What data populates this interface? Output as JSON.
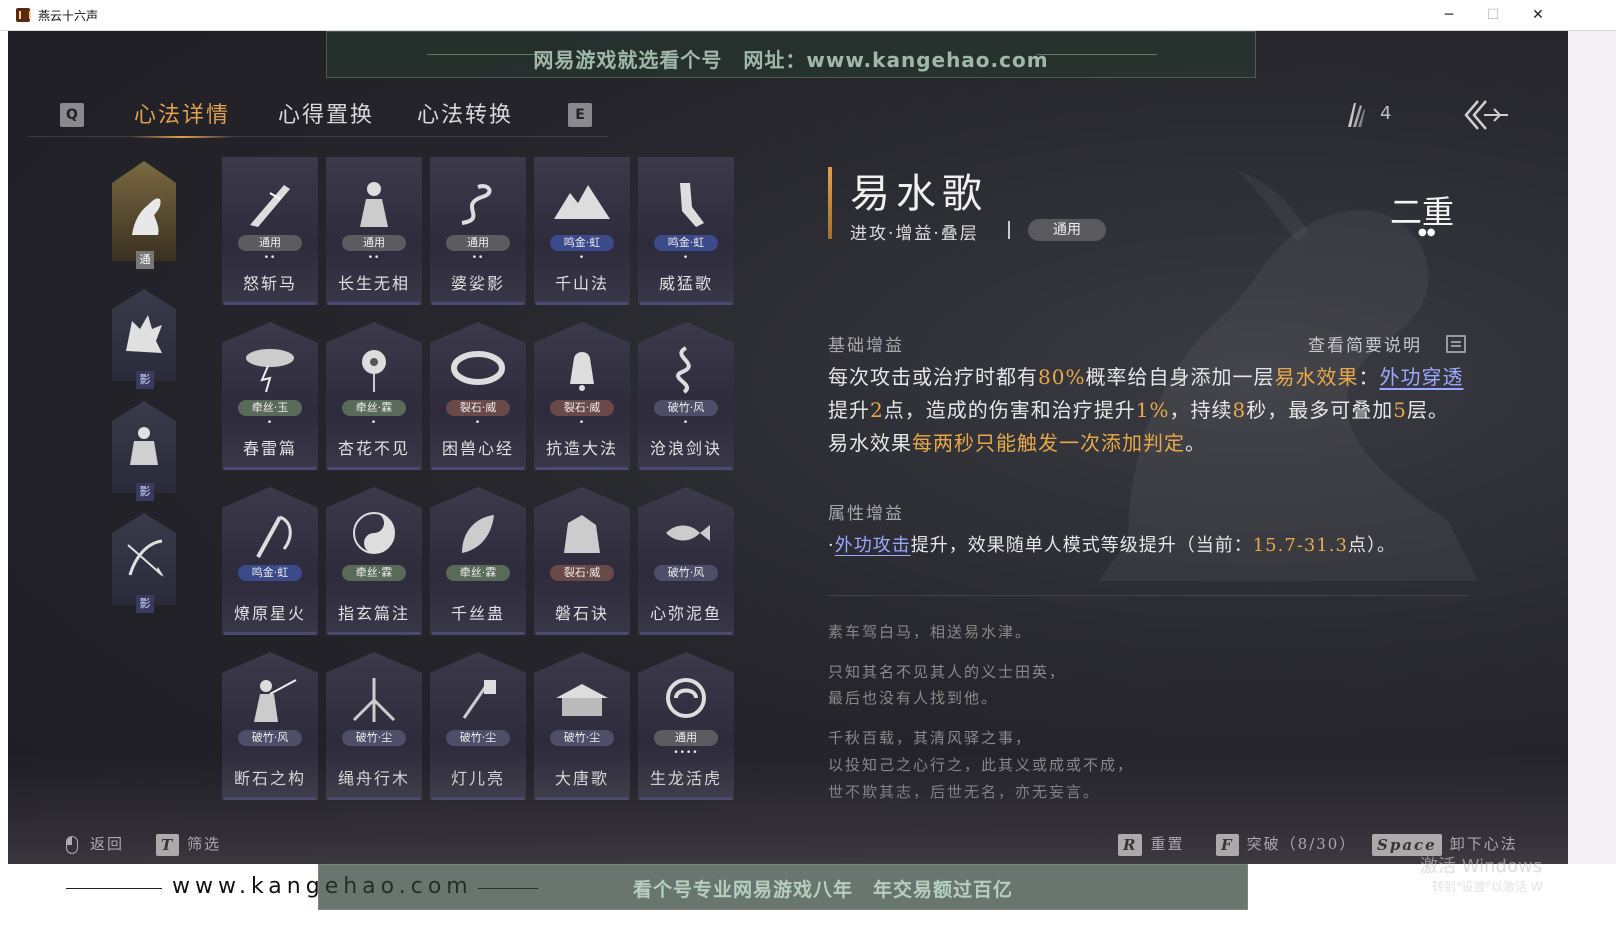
{
  "window": {
    "title": "燕云十六声",
    "minimize": "─",
    "maximize": "☐",
    "close": "✕"
  },
  "watermark": {
    "top": "网易游戏就选看个号　网址：www.kangehao.com",
    "bottom_url": "www.kangehao.com",
    "bottom_text": "看个号专业网易游戏八年　年交易额过百亿"
  },
  "tabs": {
    "prev_key": "Q",
    "next_key": "E",
    "items": [
      {
        "label": "心法详情",
        "active": true
      },
      {
        "label": "心得置换",
        "active": false
      },
      {
        "label": "心法转换",
        "active": false
      }
    ]
  },
  "currency": {
    "icon": "feather-icon",
    "value": "4"
  },
  "sidebar": [
    {
      "icon": "horse-icon",
      "tag": "通",
      "active": true
    },
    {
      "icon": "wolf-icon",
      "tag": "影",
      "active": false
    },
    {
      "icon": "warrior-icon",
      "tag": "影",
      "active": false
    },
    {
      "icon": "bow-icon",
      "tag": "影",
      "active": false
    }
  ],
  "cards": [
    {
      "name": "怒斩马",
      "badge": "通用",
      "type": "general",
      "dots": "••",
      "icon": "blade-icon"
    },
    {
      "name": "长生无相",
      "badge": "通用",
      "type": "general",
      "dots": "••",
      "icon": "figure-icon"
    },
    {
      "name": "婆娑影",
      "badge": "通用",
      "type": "general",
      "dots": "••",
      "icon": "dragon-icon"
    },
    {
      "name": "千山法",
      "badge": "鸣金·虹",
      "type": "mingjin",
      "dots": "•",
      "icon": "mountain-icon"
    },
    {
      "name": "威猛歌",
      "badge": "鸣金·虹",
      "type": "mingjin",
      "dots": "•",
      "icon": "arm-icon"
    },
    {
      "name": "春雷篇",
      "badge": "牵丝·玉",
      "type": "qiansi",
      "dots": "•",
      "icon": "storm-icon"
    },
    {
      "name": "杏花不见",
      "badge": "牵丝·霖",
      "type": "qiansi",
      "dots": "•",
      "icon": "flower-icon"
    },
    {
      "name": "困兽心经",
      "badge": "裂石·威",
      "type": "lieshi",
      "dots": "•",
      "icon": "collar-icon"
    },
    {
      "name": "抗造大法",
      "badge": "裂石·威",
      "type": "lieshi",
      "dots": "•",
      "icon": "bell-icon"
    },
    {
      "name": "沧浪剑诀",
      "badge": "破竹·风",
      "type": "pozhu",
      "dots": "•",
      "icon": "serpent-icon"
    },
    {
      "name": "燎原星火",
      "badge": "鸣金·虹",
      "type": "mingjin",
      "dots": "",
      "icon": "scythe-icon"
    },
    {
      "name": "指玄篇注",
      "badge": "牵丝·霖",
      "type": "qiansi",
      "dots": "",
      "icon": "yinyang-icon"
    },
    {
      "name": "千丝蛊",
      "badge": "牵丝·霖",
      "type": "qiansi",
      "dots": "",
      "icon": "leaf-icon"
    },
    {
      "name": "磐石诀",
      "badge": "裂石·威",
      "type": "lieshi",
      "dots": "",
      "icon": "rock-icon"
    },
    {
      "name": "心弥泥鱼",
      "badge": "破竹·风",
      "type": "pozhu",
      "dots": "",
      "icon": "fish-icon"
    },
    {
      "name": "断石之构",
      "badge": "破竹·风",
      "type": "pozhu",
      "dots": "",
      "icon": "swordsman-icon"
    },
    {
      "name": "绳舟行木",
      "badge": "破竹·尘",
      "type": "pozhu",
      "dots": "",
      "icon": "roots-icon"
    },
    {
      "name": "灯儿亮",
      "badge": "破竹·尘",
      "type": "pozhu",
      "dots": "",
      "icon": "lantern-icon"
    },
    {
      "name": "大唐歌",
      "badge": "破竹·尘",
      "type": "pozhu",
      "dots": "",
      "icon": "palace-icon"
    },
    {
      "name": "生龙活虎",
      "badge": "通用",
      "type": "general",
      "dots": "••••",
      "icon": "spiral-icon"
    }
  ],
  "badge_colors": {
    "general": "#5c5c60",
    "mingjin": "#3b4a8a",
    "qiansi": "#5a6a58",
    "lieshi": "#6a4a48",
    "pozhu": "#4e4e68"
  },
  "detail": {
    "name": "易水歌",
    "tags": "进攻·增益·叠层",
    "badge": "通用",
    "rank": "二重",
    "rank_dots": "●●",
    "basic_title": "基础增益",
    "brief_label": "查看简要说明",
    "desc": {
      "p1": "每次攻击或治疗时都有",
      "v1": "80%",
      "p2": "概率给自身添加一层",
      "kw1": "易水效果",
      "p3": "：",
      "link1": "外功穿透",
      "p4": "提升",
      "v2": "2",
      "p5": "点，造成的伤害和治疗提升",
      "v3": "1%",
      "p6": "，持续",
      "v4": "8",
      "p7": "秒，最多可叠加",
      "v5": "5",
      "p8": "层。易水效果",
      "kw2": "每两秒只能触发一次添加判定",
      "p9": "。"
    },
    "attr_title": "属性增益",
    "attr": {
      "bullet": "·",
      "link": "外功攻击",
      "text": "提升，效果随单人模式等级提升（当前：",
      "value": "15.7-31.3",
      "unit": "点）。"
    },
    "poem": [
      "素车驾白马，相送易水津。",
      "只知其名不见其人的义士田英，",
      "最后也没有人找到他。",
      "千秋百载，其清风驿之事，",
      "以投知己之心行之，此其义或成或不成，",
      "世不欺其志，后世无名，亦无妄言。"
    ]
  },
  "hints": {
    "back": "返回",
    "filter_key": "T",
    "filter": "筛选",
    "reset_key": "R",
    "reset": "重置",
    "break_key": "F",
    "break": "突破（8/30）",
    "unload_key": "Space",
    "unload": "卸下心法"
  },
  "os_overlay": {
    "line1": "激活 Windows",
    "line2": "转到\"设置\"以激活 W"
  },
  "colors": {
    "accent": "#e0a050",
    "link": "#9aa8ff",
    "highlight": "#e8a84a"
  }
}
